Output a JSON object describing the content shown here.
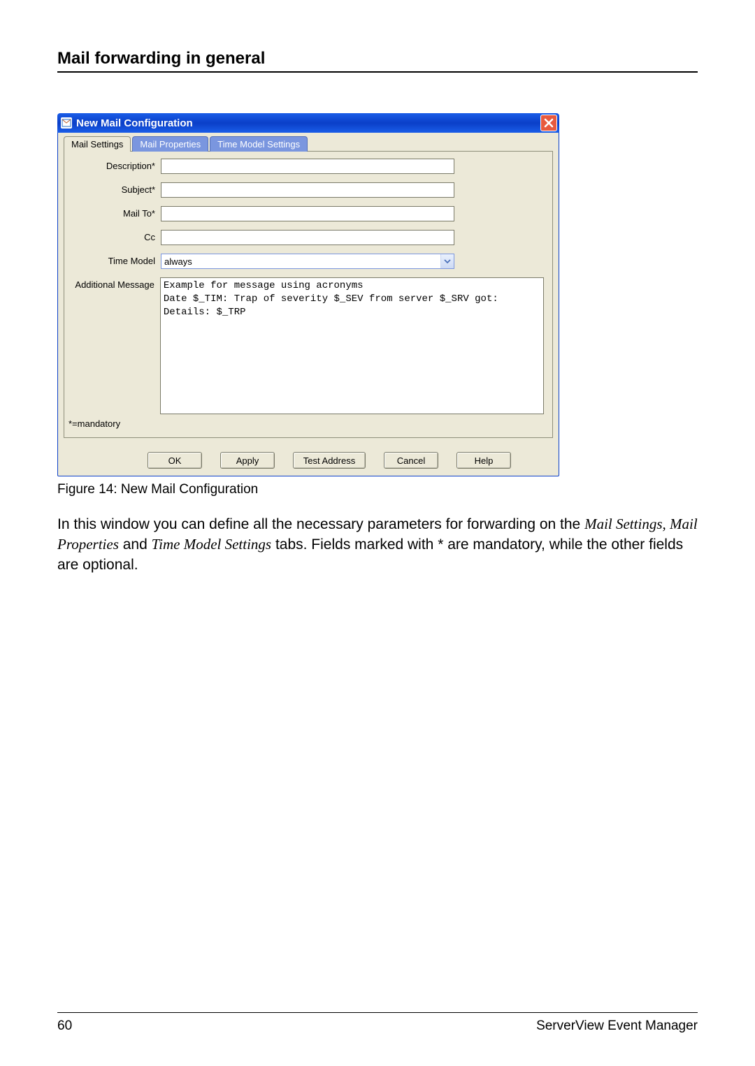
{
  "heading": "Mail forwarding in general",
  "dialog": {
    "title": "New Mail Configuration",
    "tabs": [
      "Mail Settings",
      "Mail Properties",
      "Time Model Settings"
    ],
    "labels": {
      "description": "Description*",
      "subject": "Subject*",
      "mailto": "Mail To*",
      "cc": "Cc",
      "timemodel": "Time Model",
      "additional": "Additional Message",
      "mandatory": "*=mandatory"
    },
    "timemodel_value": "always",
    "additional_value": "Example for message using acronyms\nDate $_TIM: Trap of severity $_SEV from server $_SRV got:\nDetails: $_TRP",
    "buttons": {
      "ok": "OK",
      "apply": "Apply",
      "test": "Test Address",
      "cancel": "Cancel",
      "help": "Help"
    }
  },
  "caption": "Figure 14: New Mail Configuration",
  "paragraph": {
    "p1": "In this window you can define all the necessary parameters for forwarding on the ",
    "i1": "Mail Settings, Mail Properties",
    "p2": " and ",
    "i2": "Time Model Settings",
    "p3": " tabs. Fields marked with * are mandatory, while the other fields are optional."
  },
  "footer": {
    "page": "60",
    "doc": "ServerView Event Manager"
  }
}
